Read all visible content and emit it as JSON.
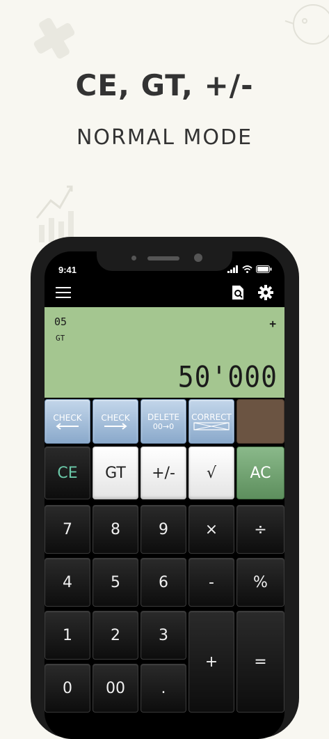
{
  "headline": "CE, GT, +/-",
  "subheadline": "NORMAL MODE",
  "status": {
    "time": "9:41"
  },
  "toolbar": {
    "menu_icon": "menu-icon",
    "history_icon": "history-search-icon",
    "settings_icon": "gear-icon"
  },
  "display": {
    "count": "05",
    "gt_indicator": "GT",
    "operator": "+",
    "value": "50'000"
  },
  "function_keys": {
    "check_back": {
      "label": "CHECK",
      "icon": "arrow-left"
    },
    "check_forward": {
      "label": "CHECK",
      "icon": "arrow-right"
    },
    "delete": {
      "label": "DELETE",
      "sub": "00→0"
    },
    "correct": {
      "label": "CORRECT"
    }
  },
  "keys": {
    "ce": "CE",
    "gt": "GT",
    "plus_minus": "+/-",
    "sqrt": "√",
    "ac": "AC",
    "seven": "7",
    "eight": "8",
    "nine": "9",
    "multiply": "×",
    "divide": "÷",
    "four": "4",
    "five": "5",
    "six": "6",
    "minus": "-",
    "percent": "%",
    "one": "1",
    "two": "2",
    "three": "3",
    "plus": "+",
    "equals": "=",
    "zero": "0",
    "double_zero": "00",
    "decimal": "."
  },
  "colors": {
    "display_bg": "#a4c690",
    "background": "#f8f7f1",
    "ac_key": "#6b9e6b",
    "ce_text": "#6bc8a8"
  }
}
